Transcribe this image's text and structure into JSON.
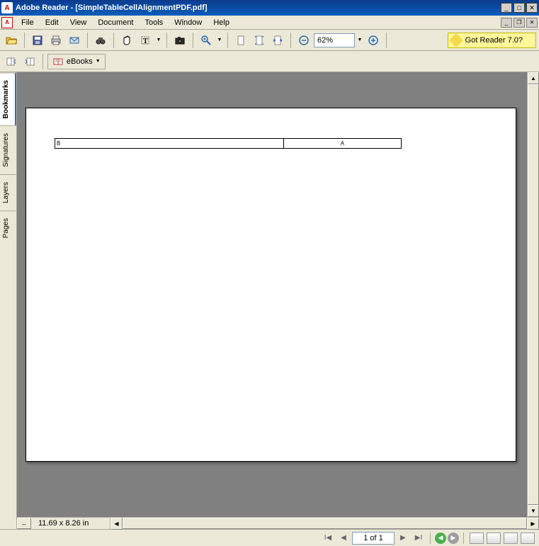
{
  "app_icon_letter": "A",
  "title": "Adobe Reader - [SimpleTableCellAlignmentPDF.pdf]",
  "menu": {
    "file": "File",
    "edit": "Edit",
    "view": "View",
    "document": "Document",
    "tools": "Tools",
    "window": "Window",
    "help": "Help"
  },
  "toolbar": {
    "zoom_value": "62%",
    "promo": "Got Reader 7.0?",
    "ebooks": "eBooks"
  },
  "side": {
    "bookmarks": "Bookmarks",
    "signatures": "Signatures",
    "layers": "Layers",
    "pages": "Pages"
  },
  "doc": {
    "cell_b": "B",
    "cell_a": "A",
    "dimensions": "11.69 x 8.26 in"
  },
  "status": {
    "page": "1 of 1"
  }
}
